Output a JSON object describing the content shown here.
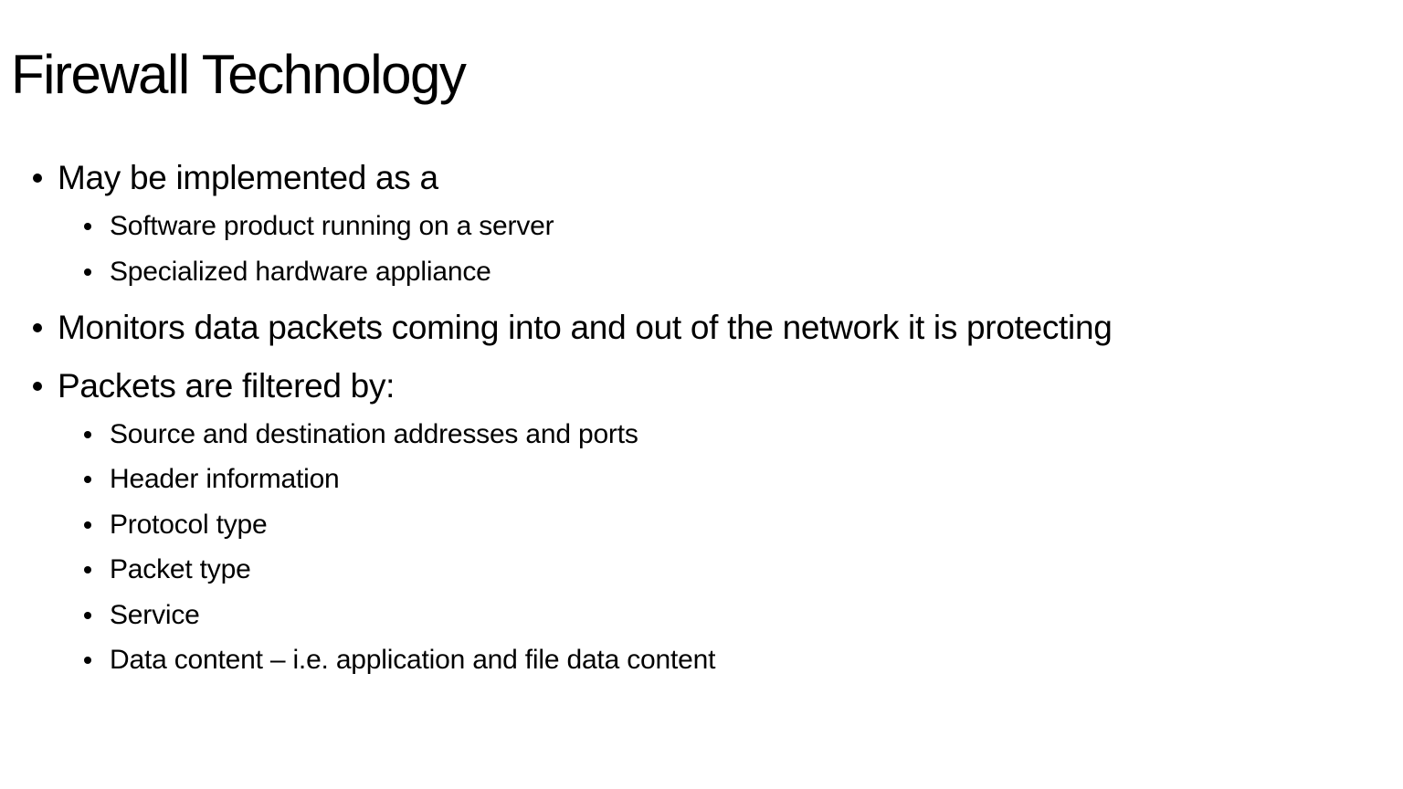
{
  "slide": {
    "title": "Firewall Technology",
    "bullets": [
      {
        "text": "May be implemented as a",
        "children": [
          "Software product running on a server",
          "Specialized hardware appliance"
        ]
      },
      {
        "text": "Monitors data packets coming into and out of the network it is protecting",
        "children": []
      },
      {
        "text": "Packets are filtered by:",
        "children": [
          "Source and destination addresses and ports",
          "Header information",
          "Protocol type",
          "Packet type",
          "Service",
          "Data content – i.e. application and file data content"
        ]
      }
    ]
  }
}
